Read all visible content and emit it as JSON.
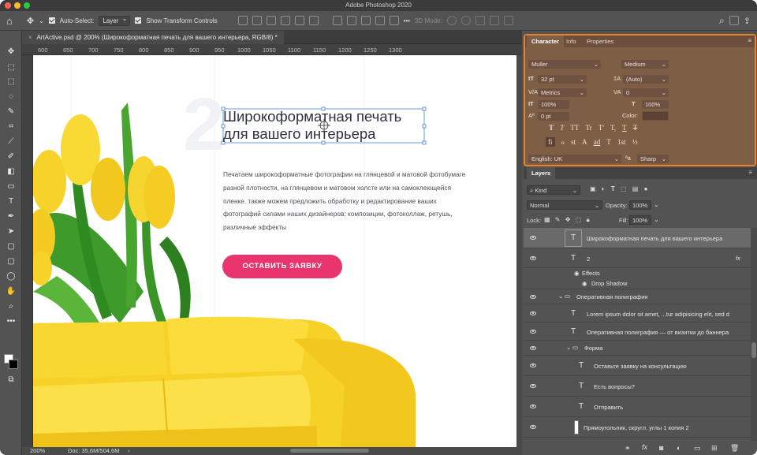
{
  "app": {
    "title": "Adobe Photoshop 2020"
  },
  "options_bar": {
    "auto_select_label": "Auto-Select:",
    "auto_select_value": "Layer",
    "transform_label": "Show Transform Controls",
    "mode_label": "3D Mode:",
    "more": "•••"
  },
  "document": {
    "tab_title": "ArtActive.psd @ 200% (Широкоформатная печать  для вашего интерьера, RGB/8) *",
    "close": "×"
  },
  "ruler": {
    "ticks": [
      "600",
      "650",
      "700",
      "750",
      "800",
      "850",
      "900",
      "950",
      "1000",
      "1050",
      "1100",
      "1150",
      "1200",
      "1250",
      "1300"
    ]
  },
  "status": {
    "zoom": "200%",
    "doc": "Doc: 35,6M/504,6M",
    "arrow": "›"
  },
  "canvas": {
    "big_digit": "2",
    "heading_line1": "Широкоформатная печать",
    "heading_line2": "для вашего интерьера",
    "paragraph_lines": [
      "Печатаем широкоформатные фотографии на глянцевой и матовой фотобумаге",
      "разной плотности, на глянцевом и матовом холсте или на самоклеющейся",
      "пленке. также можем предложить обработку и редактирование ваших",
      "фотографий силами наших дизайнеров: композиции, фотоколлаж, ретушь,",
      "различные эффекты"
    ],
    "button_label": "ОСТАВИТЬ ЗАЯВКУ"
  },
  "character_panel": {
    "tabs": [
      "Character",
      "Info",
      "Properties"
    ],
    "font_family": "Muller",
    "font_style": "Medium",
    "font_size": "32 pt",
    "leading": "(Auto)",
    "kerning": "Metrics",
    "tracking": "0",
    "vscale": "100%",
    "hscale": "100%",
    "baseline": "0 pt",
    "color_label": "Color:",
    "type_buttons": [
      "T",
      "T",
      "TT",
      "Tr",
      "T'",
      "T,",
      "T",
      "T"
    ],
    "ot_buttons": [
      "fi",
      "ℴ",
      "st",
      "A",
      "ad",
      "T",
      "1st",
      "½"
    ],
    "language": "English: UK",
    "aa_label": "ªa",
    "antialias": "Sharp",
    "colors": {
      "accent": "#e7832d",
      "panel": "#7f5e46"
    }
  },
  "layers_panel": {
    "title": "Layers",
    "kind": "Kind",
    "blend": "Normal",
    "opacity_label": "Opacity:",
    "opacity": "100%",
    "lock_label": "Lock:",
    "fill_label": "Fill:",
    "fill": "100%",
    "fx": "fx",
    "rows": [
      {
        "name": "Широкоформатная печать  для вашего интерьера",
        "kind": "T"
      },
      {
        "name": "2",
        "kind": "T"
      },
      {
        "name": "Effects",
        "kind": "effects"
      },
      {
        "name": "Drop Shadow",
        "kind": "effect"
      },
      {
        "name": "Оперативная полиграфия",
        "kind": "group"
      },
      {
        "name": "Lorem ipsum dolor sit amet, ...tur adipisicing elit, sed d",
        "kind": "T"
      },
      {
        "name": "Оперативная полиграфия — от визитки до баннера",
        "kind": "T"
      },
      {
        "name": "Форма",
        "kind": "group"
      },
      {
        "name": "Оставьте заявку на консультацию",
        "kind": "T"
      },
      {
        "name": "Есть вопросы?",
        "kind": "T"
      },
      {
        "name": "Отправить",
        "kind": "T"
      },
      {
        "name": "Прямоугольник, скругл. углы 1 копия 2",
        "kind": "shape"
      }
    ]
  }
}
